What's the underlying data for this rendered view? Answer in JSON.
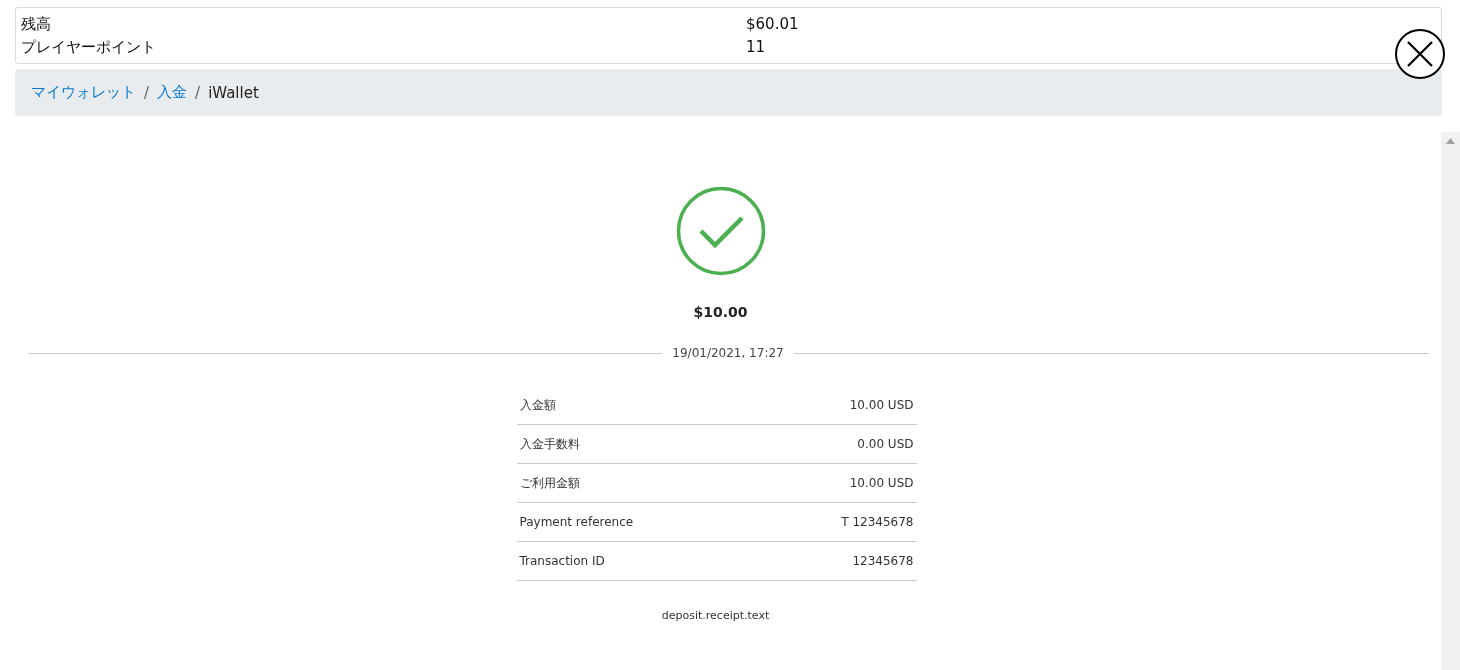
{
  "account_summary": [
    {
      "label": "残高",
      "value": "$60.01"
    },
    {
      "label": "プレイヤーポイント",
      "value": "11"
    }
  ],
  "breadcrumb": [
    {
      "label": "マイウォレット",
      "kind": "link"
    },
    {
      "label": "/",
      "kind": "separator"
    },
    {
      "label": "入金",
      "kind": "link"
    },
    {
      "label": "/",
      "kind": "separator"
    },
    {
      "label": "iWallet",
      "kind": "current"
    }
  ],
  "receipt": {
    "amount": "$10.00",
    "date": "19/01/2021, 17:27",
    "rows": [
      {
        "label": "入金額",
        "value": "10.00 USD"
      },
      {
        "label": "入金手数料",
        "value": "0.00 USD"
      },
      {
        "label": "ご利用金額",
        "value": "10.00 USD"
      },
      {
        "label": "Payment reference",
        "value": "T 12345678"
      },
      {
        "label": "Transaction ID",
        "value": "12345678"
      }
    ],
    "footer": "deposit.receipt.text"
  }
}
